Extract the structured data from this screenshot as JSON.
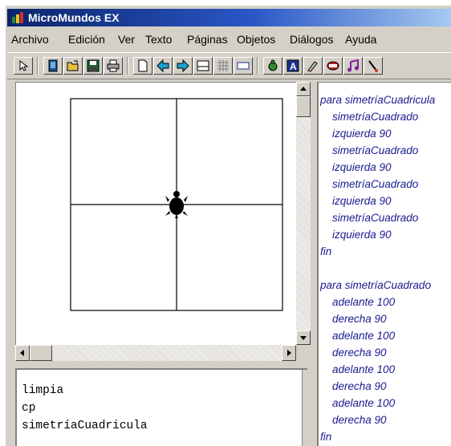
{
  "window": {
    "title": "MicroMundos EX"
  },
  "menu": [
    "Archivo",
    "Edición",
    "Ver",
    "Texto",
    "Páginas",
    "Objetos",
    "Diálogos",
    "Ayuda"
  ],
  "toolbar": {
    "buttons": [
      "pointer-icon",
      "new-page-icon",
      "open-folder-icon",
      "save-icon",
      "print-icon",
      "blank-page-icon",
      "arrow-left-icon",
      "arrow-right-icon",
      "split-view-icon",
      "grid-icon",
      "rectangle-icon",
      "turtle-icon",
      "text-box-icon",
      "paint-icon",
      "button-icon",
      "music-icon",
      "paint-brush-icon"
    ]
  },
  "procedures": {
    "lines": [
      "para simetríaCuadricula",
      "simetríaCuadrado",
      "izquierda 90",
      "simetríaCuadrado",
      "izquierda 90",
      "simetríaCuadrado",
      "izquierda 90",
      "simetríaCuadrado",
      "izquierda 90",
      "fin",
      "para simetríaCuadrado",
      "adelante 100",
      "derecha 90",
      "adelante 100",
      "derecha 90",
      "adelante 100",
      "derecha 90",
      "adelante 100",
      "derecha 90",
      "fin"
    ]
  },
  "command_center": {
    "lines": [
      "limpia",
      "cp",
      "simetríaCuadricula"
    ]
  },
  "colors": {
    "title_start": "#0a246a",
    "title_end": "#a6caf0",
    "procedure_text": "#1a1a90",
    "face": "#d4d0c8"
  }
}
